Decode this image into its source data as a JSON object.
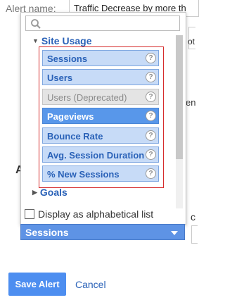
{
  "background": {
    "alert_name_label": "Alert name:",
    "alert_name_value": "Traffic Decrease by more th",
    "frag_ot": "ot",
    "frag_en": "en",
    "frag_a": "A",
    "frag_c": "c"
  },
  "picker": {
    "search": {
      "placeholder": ""
    },
    "categories": [
      {
        "label": "Site Usage",
        "expanded": true
      },
      {
        "label": "Goals",
        "expanded": false
      }
    ],
    "items": [
      {
        "label": "Sessions",
        "state": "normal"
      },
      {
        "label": "Users",
        "state": "normal"
      },
      {
        "label": "Users (Deprecated)",
        "state": "deprecated"
      },
      {
        "label": "Pageviews",
        "state": "selected"
      },
      {
        "label": "Bounce Rate",
        "state": "normal"
      },
      {
        "label": "Avg. Session Duration",
        "state": "normal"
      },
      {
        "label": "% New Sessions",
        "state": "normal"
      }
    ],
    "help_glyph": "?",
    "alpha_checkbox_label": "Display as alphabetical list",
    "alpha_checked": false
  },
  "metric_dropdown": {
    "value": "Sessions"
  },
  "actions": {
    "save_label": "Save Alert",
    "cancel_label": "Cancel"
  },
  "colors": {
    "accent": "#5e93e5",
    "highlight_border": "#d62b2b",
    "link": "#2a62b8"
  }
}
